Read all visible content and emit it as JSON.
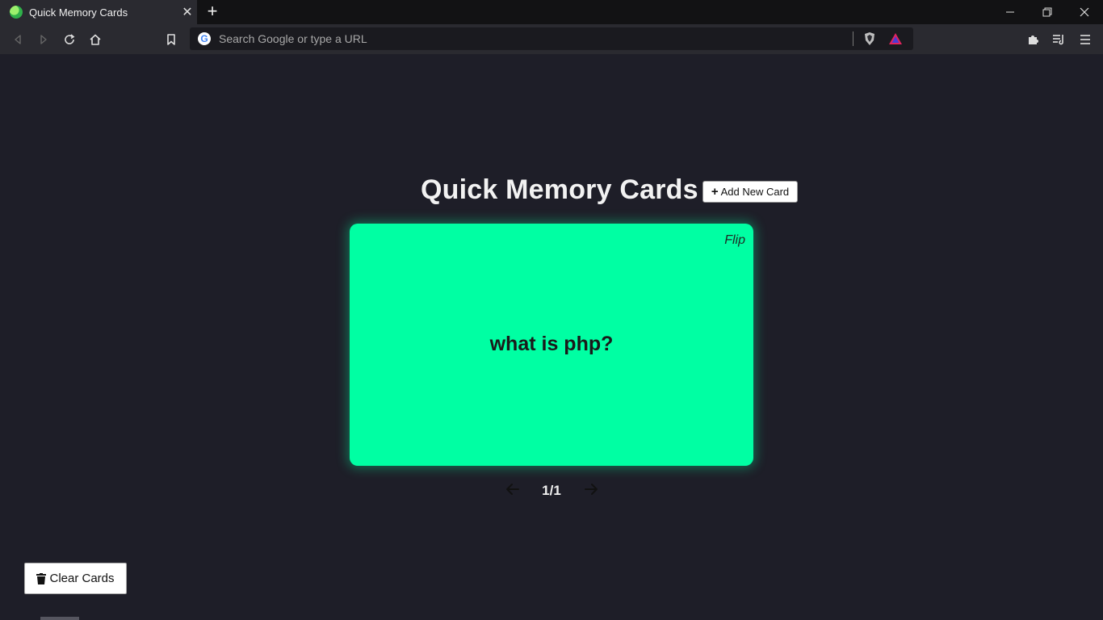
{
  "browser": {
    "tab_title": "Quick Memory Cards",
    "tab_close": "✕",
    "new_tab": "+",
    "omnibox_placeholder": "Search Google or type a URL",
    "google_letter": "G"
  },
  "page": {
    "title": "Quick Memory Cards",
    "add_button_plus": "+",
    "add_button_label": "Add New Card",
    "card": {
      "flip_label": "Flip",
      "question": "what is php?"
    },
    "counter": "1/1",
    "clear_button_label": "Clear Cards"
  },
  "colors": {
    "background": "#1e1e28",
    "card": "#00ffa3"
  }
}
